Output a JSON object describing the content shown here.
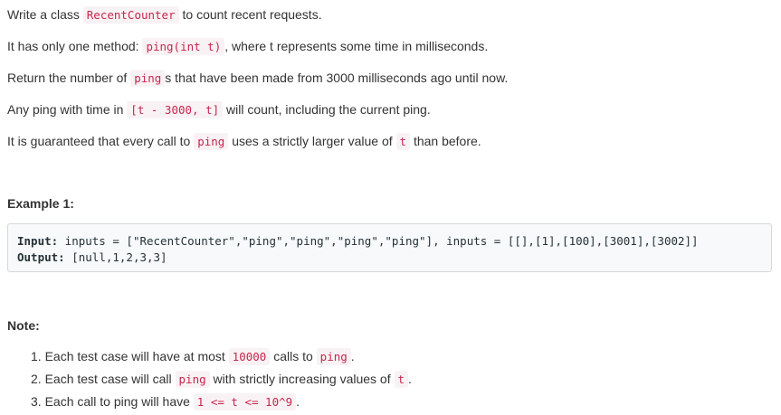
{
  "paragraphs": {
    "p1": {
      "pre": "Write a class ",
      "code": "RecentCounter",
      "post": " to count recent requests."
    },
    "p2": {
      "pre": "It has only one method: ",
      "code": "ping(int t)",
      "post": ", where t represents some time in milliseconds."
    },
    "p3": {
      "pre": "Return the number of ",
      "code": "ping",
      "post": "s that have been made from 3000 milliseconds ago until now."
    },
    "p4": {
      "pre": "Any ping with time in ",
      "code": "[t - 3000, t]",
      "post": " will count, including the current ping."
    },
    "p5": {
      "pre": "It is guaranteed that every call to ",
      "code": "ping",
      "mid": " uses a strictly larger value of ",
      "code2": "t",
      "post": " than before."
    }
  },
  "example": {
    "heading": "Example 1:",
    "input_label": "Input:",
    "input_value": " inputs = [\"RecentCounter\",\"ping\",\"ping\",\"ping\",\"ping\"], inputs = [[],[1],[100],[3001],[3002]]",
    "output_label": "Output:",
    "output_value": " [null,1,2,3,3]"
  },
  "note": {
    "heading": "Note:",
    "items": [
      {
        "num": "1.",
        "pre": " Each test case will have at most ",
        "code": "10000",
        "mid": " calls to ",
        "code2": "ping",
        "post": "."
      },
      {
        "num": "2.",
        "pre": " Each test case will call ",
        "code": "ping",
        "mid": " with strictly increasing values of ",
        "code2": "t",
        "post": "."
      },
      {
        "num": "3.",
        "pre": " Each call to ping will have ",
        "code": "1 <= t <= 10^9",
        "post": "."
      }
    ]
  }
}
